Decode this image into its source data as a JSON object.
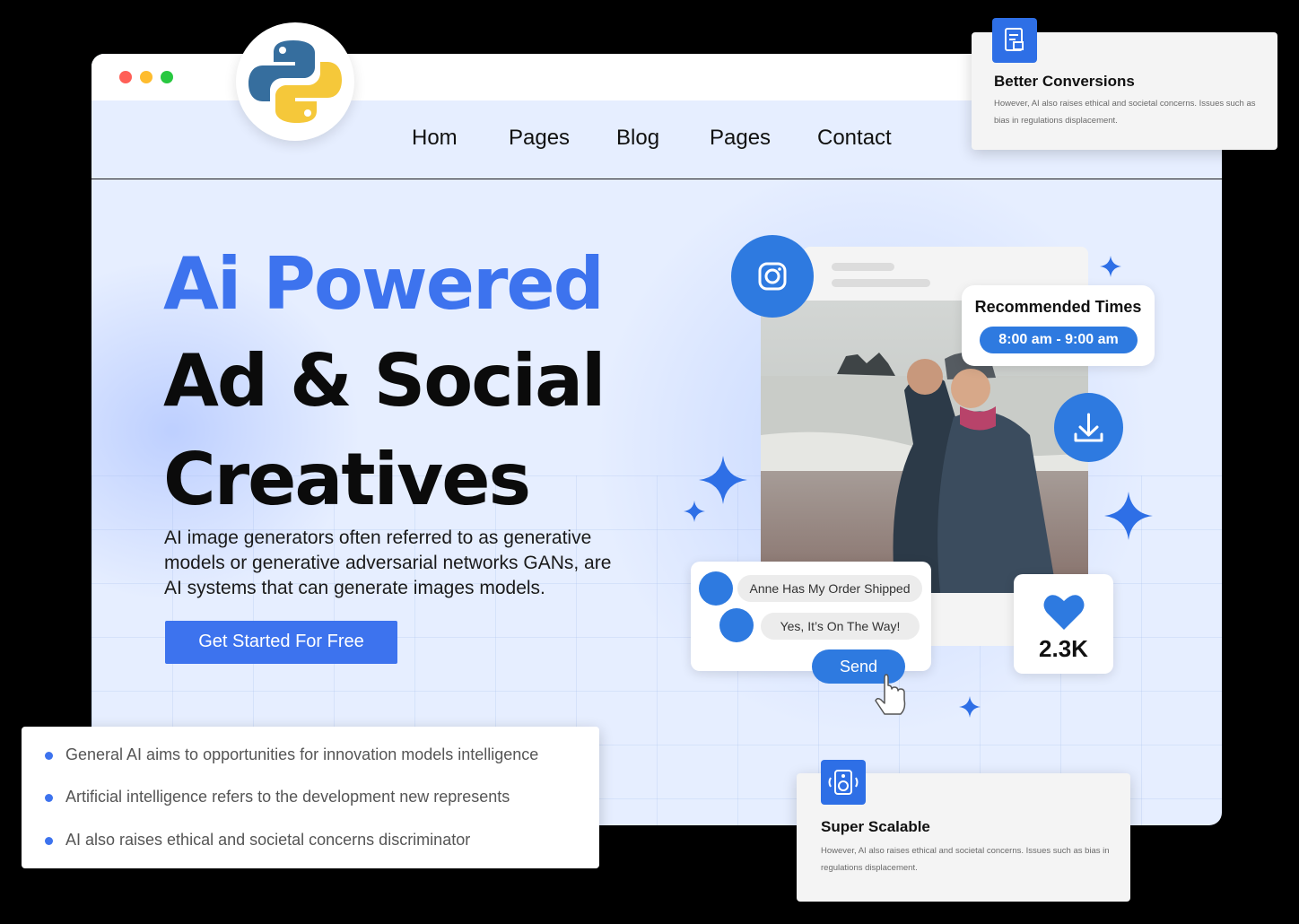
{
  "window": {
    "controls": [
      "close",
      "minimize",
      "maximize"
    ]
  },
  "badge": {
    "icon": "python-logo-icon"
  },
  "nav": {
    "items": [
      {
        "label": "Hom"
      },
      {
        "label": "Pages"
      },
      {
        "label": "Blog"
      },
      {
        "label": "Pages"
      },
      {
        "label": "Contact"
      }
    ]
  },
  "hero": {
    "title_line1": "Ai Powered",
    "title_line2": "Ad & Social",
    "title_line3": "Creatives",
    "description": "AI image generators often referred to as generative models or generative adversarial networks GANs, are AI systems that can generate images models.",
    "cta_label": "Get Started For Free"
  },
  "social_mock": {
    "platform_icon": "instagram-icon",
    "recommended_title": "Recommended Times",
    "recommended_time": "8:00 am - 9:00 am",
    "download_icon": "download-icon",
    "chat": {
      "message1": "Anne Has My Order Shipped",
      "message2": "Yes, It’s On The Way!",
      "send_label": "Send"
    },
    "likes": {
      "icon": "heart-icon",
      "count": "2.3K"
    }
  },
  "features": {
    "top": {
      "icon": "document-edit-icon",
      "title": "Better Conversions",
      "description": "However, AI also raises ethical and societal concerns. Issues such as bias in regulations displacement."
    },
    "bottom": {
      "icon": "speaker-icon",
      "title": "Super Scalable",
      "description": "However, AI also raises ethical and societal concerns. Issues such as bias in regulations displacement."
    }
  },
  "bullets": [
    "General AI aims to opportunities for innovation models intelligence",
    "Artificial intelligence refers to the development new represents",
    "AI also raises ethical and societal concerns discriminator"
  ],
  "colors": {
    "accent": "#3d73ee",
    "secondary_blue": "#2e7ae0",
    "page_background": "#e6eeff",
    "outer_background": "#000000"
  }
}
